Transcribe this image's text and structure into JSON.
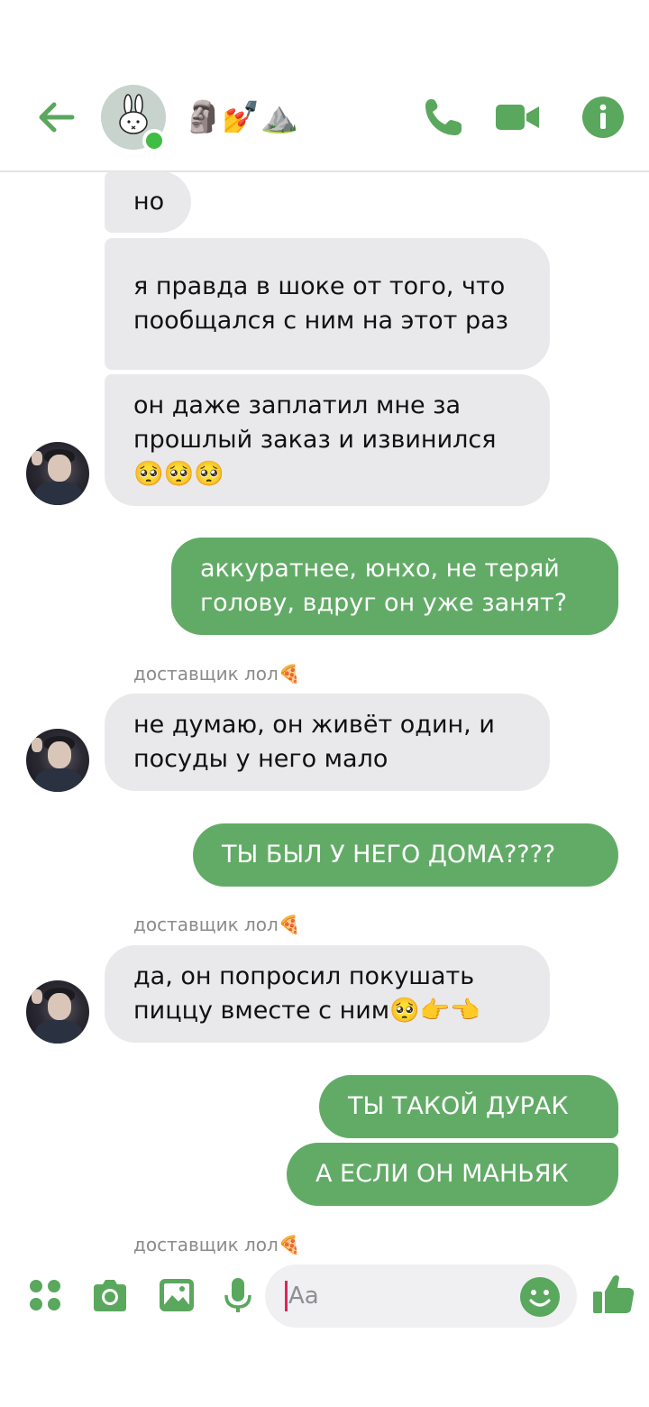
{
  "header": {
    "title": "🗿💅⛰️",
    "avatar_emoji": "bunny",
    "online": true
  },
  "colors": {
    "accent": "#5aa75e",
    "outgoing_bubble": "#62ab67",
    "incoming_bubble": "#e9e9eb"
  },
  "messages": [
    {
      "dir": "in",
      "text": "но"
    },
    {
      "dir": "in",
      "text": "я правда в шоке от того, что пообщался с ним на этот раз"
    },
    {
      "dir": "in",
      "text": "он даже заплатил мне за прошлый заказ и извинился 🥺🥺🥺"
    },
    {
      "dir": "out",
      "text": "аккуратнее, юнхо, не теряй голову, вдруг он уже занят?"
    },
    {
      "dir": "sender",
      "text": "доставщик лол🍕"
    },
    {
      "dir": "in",
      "text": "не думаю, он живёт один, и посуды у него мало"
    },
    {
      "dir": "out",
      "text": "ТЫ БЫЛ У НЕГО ДОМА????"
    },
    {
      "dir": "sender",
      "text": "доставщик лол🍕"
    },
    {
      "dir": "in",
      "text": "да, он попросил покушать пиццу вместе с ним🥺👉👈"
    },
    {
      "dir": "out",
      "text": "ТЫ ТАКОЙ ДУРАК"
    },
    {
      "dir": "out",
      "text": "А ЕСЛИ ОН МАНЬЯК"
    },
    {
      "dir": "sender",
      "text": "доставщик лол🍕"
    }
  ],
  "composer": {
    "placeholder": "Aa",
    "icons": [
      "apps-icon",
      "camera-icon",
      "image-icon",
      "microphone-icon",
      "emoji-icon",
      "thumbs-up-icon"
    ]
  }
}
